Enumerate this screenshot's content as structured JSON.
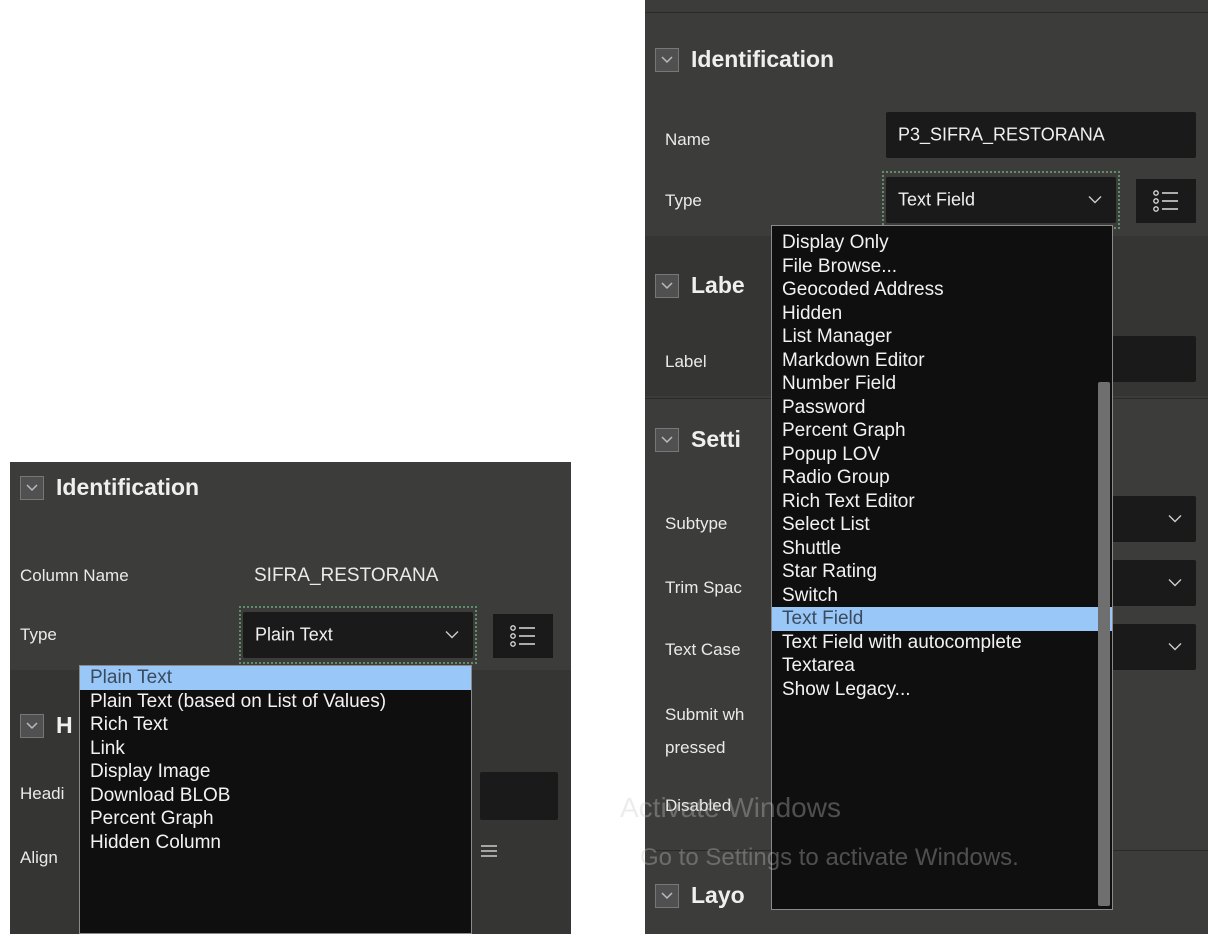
{
  "left_panel": {
    "section_title": "Identification",
    "column_name_label": "Column Name",
    "column_name_value": "SIFRA_RESTORANA",
    "type_label": "Type",
    "type_value": "Plain Text",
    "hidden_section_initial": "H",
    "heading_label_partial": "Headi",
    "alignment_label_partial": "Align",
    "dropdown_options": [
      "Plain Text",
      "Plain Text (based on List of Values)",
      "Rich Text",
      "Link",
      "Display Image",
      "Download BLOB",
      "Percent Graph",
      "Hidden Column"
    ],
    "selected_option": "Plain Text"
  },
  "right_panel": {
    "section_identification": "Identification",
    "name_label": "Name",
    "name_value": "P3_SIFRA_RESTORANA",
    "type_label": "Type",
    "type_value": "Text Field",
    "section_label_partial": "Labe",
    "label_label": "Label",
    "section_settings_partial": "Setti",
    "subtype_label": "Subtype",
    "trim_spaces_partial": "Trim Spac",
    "text_case_label": "Text Case",
    "submit_line1_partial": "Submit wh",
    "submit_line2": "pressed",
    "disabled_label": "Disabled",
    "section_layout_partial": "Layo",
    "dropdown_options": [
      "Display Only",
      "File Browse...",
      "Geocoded Address",
      "Hidden",
      "List Manager",
      "Markdown Editor",
      "Number Field",
      "Password",
      "Percent Graph",
      "Popup LOV",
      "Radio Group",
      "Rich Text Editor",
      "Select List",
      "Shuttle",
      "Star Rating",
      "Switch",
      "Text Field",
      "Text Field with autocomplete",
      "Textarea",
      "Show Legacy..."
    ],
    "selected_option": "Text Field"
  },
  "watermark": {
    "line1": "Activate Windows",
    "line2": "Go to Settings to activate Windows."
  },
  "colors": {
    "panel_bg": "#3c3c3a",
    "field_bg": "#1a1a1a",
    "dropdown_bg": "#0f0f0f",
    "selected_bg": "#99c7f7",
    "focus_ring": "#5f8f6a"
  },
  "icons": [
    "chevron-down-icon",
    "list-view-icon",
    "collapse-icon"
  ]
}
